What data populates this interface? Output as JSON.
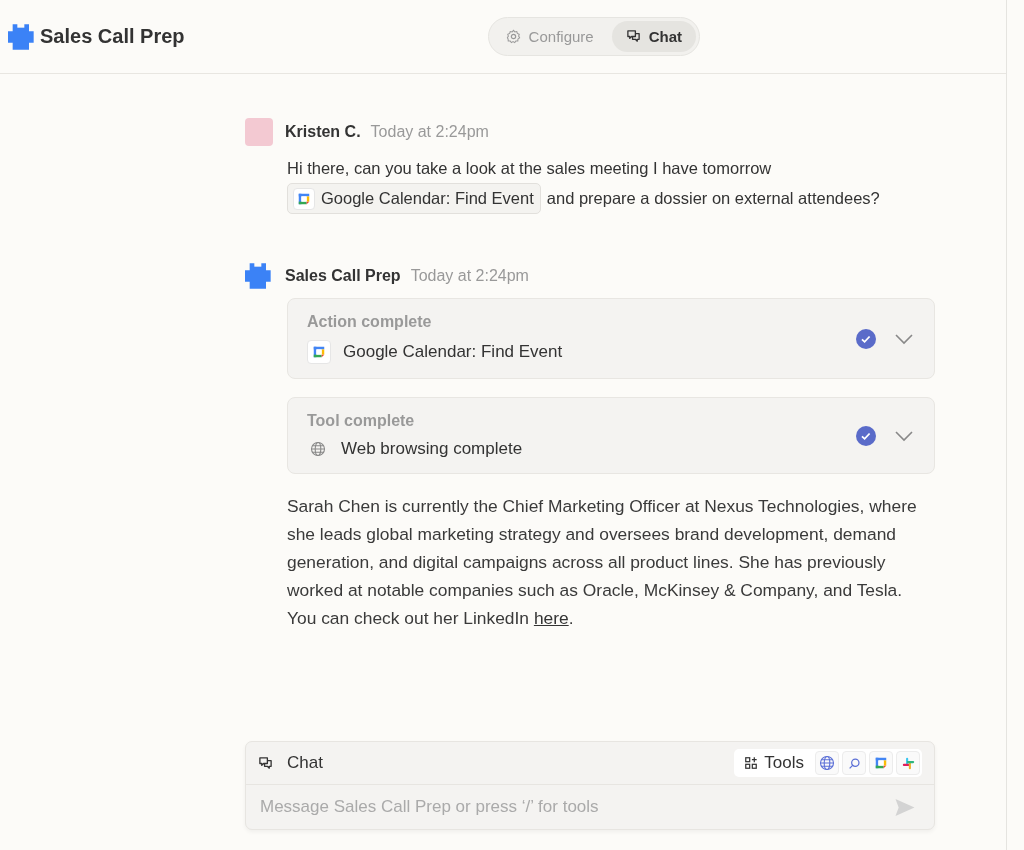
{
  "header": {
    "title": "Sales Call Prep",
    "tabs": [
      {
        "label": "Configure",
        "kind": "configure",
        "selected": false
      },
      {
        "label": "Chat",
        "kind": "chat",
        "selected": true
      }
    ]
  },
  "messages": [
    {
      "kind": "user",
      "author": "Kristen C.",
      "time": "Today at 2:24pm",
      "segments": [
        {
          "kind": "text",
          "text": "Hi there, can you take a look at the sales meeting I have tomorrow"
        },
        {
          "kind": "chip",
          "text": "Google Calendar: Find Event"
        },
        {
          "kind": "text",
          "text": "and prepare a dossier on external attendees?"
        }
      ]
    },
    {
      "kind": "bot",
      "author": "Sales Call Prep",
      "time": "Today at 2:24pm",
      "steps": [
        {
          "heading": "Action complete",
          "kind": "action",
          "label": "Google Calendar: Find Event",
          "done": true,
          "expanded": false
        },
        {
          "heading": "Tool complete",
          "kind": "tool",
          "label": "Web browsing complete",
          "done": true,
          "expanded": false
        }
      ],
      "answer": {
        "text": "Sarah Chen is currently the Chief Marketing Officer at Nexus Technologies, where she leads global marketing strategy and oversees brand development, demand generation, and digital campaigns across all product lines. She has previously worked at notable companies such as Oracle, McKinsey & Company, and Tesla. You can check out her LinkedIn ",
        "link": "here",
        "after": "."
      }
    }
  ],
  "composer": {
    "title": "Chat",
    "tools_label": "Tools",
    "tools": [
      {
        "kind": "web"
      },
      {
        "kind": "search"
      },
      {
        "kind": "calendar"
      },
      {
        "kind": "chat-app"
      }
    ],
    "placeholder": "Message Sales Call Prep or press ‘/’ for tools"
  }
}
